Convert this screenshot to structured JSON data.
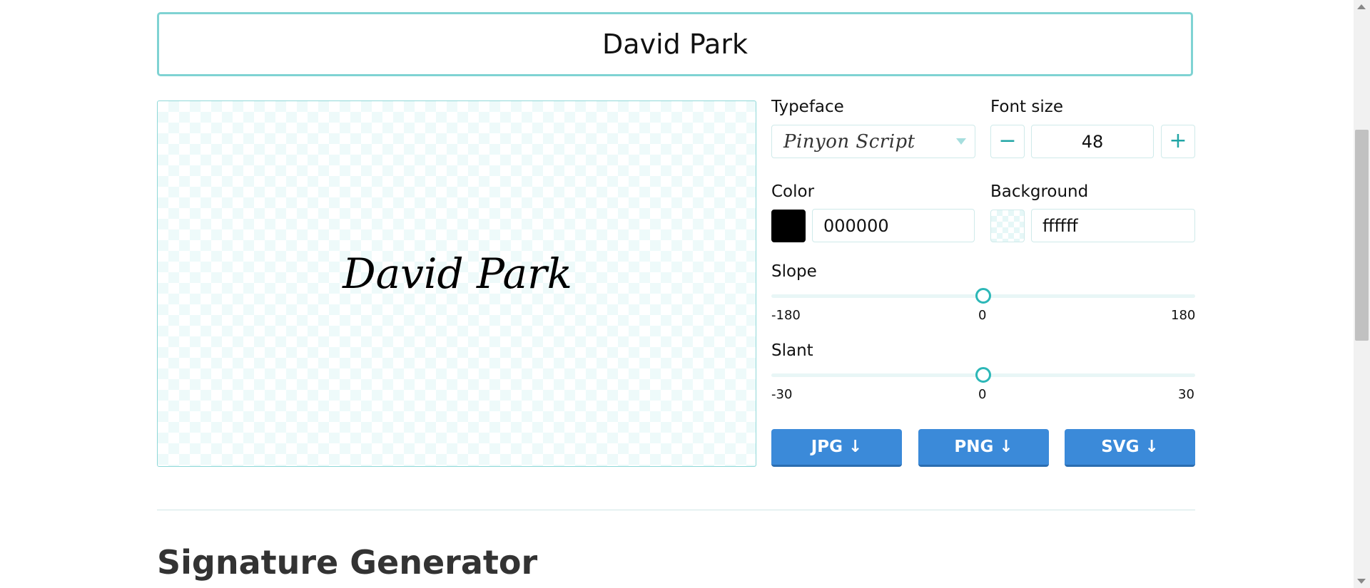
{
  "name_input": {
    "value": "David Park"
  },
  "preview": {
    "signature_text": "David Park",
    "color": "#000000"
  },
  "typeface": {
    "label": "Typeface",
    "selected": "Pinyon Script"
  },
  "font_size": {
    "label": "Font size",
    "value": "48",
    "minus": "−",
    "plus": "+"
  },
  "color": {
    "label": "Color",
    "value": "000000",
    "swatch": "#000000"
  },
  "background": {
    "label": "Background",
    "value": "ffffff"
  },
  "slope": {
    "label": "Slope",
    "min": "-180",
    "mid": "0",
    "max": "180",
    "value": 0,
    "range": [
      -180,
      180
    ]
  },
  "slant": {
    "label": "Slant",
    "min": "-30",
    "mid": "0",
    "max": "30",
    "value": 0,
    "range": [
      -30,
      30
    ]
  },
  "downloads": {
    "jpg": "JPG ↓",
    "png": "PNG ↓",
    "svg": "SVG ↓"
  },
  "section": {
    "heading": "Signature Generator"
  },
  "colors": {
    "accent": "#2cb7b7",
    "button": "#3b8ad9",
    "border": "#7fd3d3"
  }
}
